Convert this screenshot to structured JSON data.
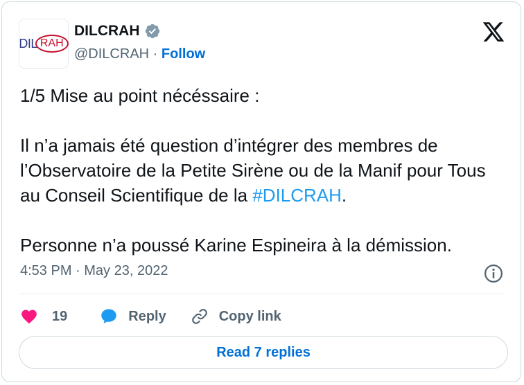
{
  "account": {
    "name": "DILCRAH",
    "handle": "@DILCRAH",
    "separator": "·",
    "follow_label": "Follow",
    "avatar_text_a": "DIL",
    "avatar_text_b": "RAH"
  },
  "tweet": {
    "line1": "1/5 Mise au point nécéssaire :",
    "para2_before": "Il n’a jamais été question d’intégrer des membres de l’Observatoire de la Petite Sirène ou de la Manif pour Tous au Conseil Scientifique de la ",
    "hashtag": "#DILCRAH",
    "para2_after": ".",
    "para3": "Personne n’a poussé Karine Espineira à la démission."
  },
  "meta": {
    "timestamp": "4:53 PM · May 23, 2022"
  },
  "actions": {
    "like_count": "19",
    "reply_label": "Reply",
    "copy_label": "Copy link"
  },
  "read_replies": "Read 7 replies",
  "colors": {
    "link": "#006fd6",
    "hashtag": "#1d9bf0",
    "like": "#f91880",
    "reply": "#1d9bf0",
    "verified": "#829aab"
  },
  "icons": [
    "verified-badge-icon",
    "x-logo-icon",
    "info-icon",
    "heart-icon",
    "reply-bubble-icon",
    "link-icon"
  ]
}
